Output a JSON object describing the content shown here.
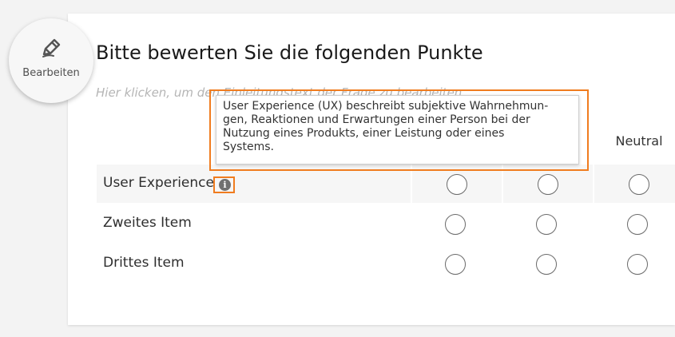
{
  "edit": {
    "label": "Bearbeiten",
    "icon": "pencil-icon"
  },
  "question": {
    "title": "Bitte bewerten Sie die folgenden Punkte",
    "subtitle": "Hier klicken, um den Einleitungstext der Frage zu bearbeiten"
  },
  "scale": {
    "visible_header": "Neutral"
  },
  "items": [
    {
      "label": "User Experience",
      "has_info": true
    },
    {
      "label": "Zweites Item",
      "has_info": false
    },
    {
      "label": "Drittes Item",
      "has_info": false
    }
  ],
  "tooltip": {
    "text": "User Experience (UX) beschreibt subjektive Wahrnehmun-\ngen, Reaktionen und Erwartungen einer Person bei der\nNutzung eines Produkts, einer Leistung oder eines\nSystems."
  },
  "colors": {
    "highlight": "#f07c1f",
    "row_shade": "#f6f6f6",
    "info_icon": "#707070"
  }
}
